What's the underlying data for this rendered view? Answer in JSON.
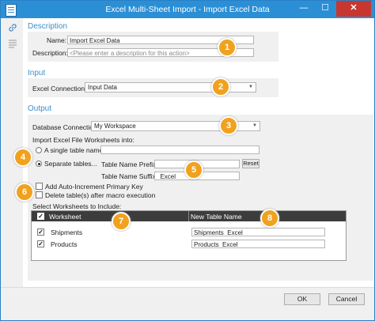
{
  "window": {
    "title": "Excel Multi-Sheet Import - Import Excel Data",
    "minimize": "—",
    "maximize": "☐",
    "close": "✕"
  },
  "description": {
    "section_title": "Description",
    "name_label": "Name:",
    "name_value": "Import Excel Data",
    "description_label": "Description:",
    "description_placeholder": "<Please enter a description for this action>"
  },
  "input": {
    "section_title": "Input",
    "connection_label": "Excel Connection:",
    "connection_value": "Input Data"
  },
  "output": {
    "section_title": "Output",
    "db_connection_label": "Database Connection:",
    "db_connection_value": "My Workspace",
    "import_into_label": "Import Excel File Worksheets into:",
    "single_table_label": "A single table named:",
    "separate_tables_label": "Separate tables...",
    "prefix_label": "Table Name Prefix:",
    "prefix_value": "",
    "reset_label": "Reset",
    "suffix_label": "Table Name Suffix:",
    "suffix_value": "_Excel",
    "auto_increment_label": "Add Auto-Increment Primary Key",
    "delete_tables_label": "Delete table(s) after macro execution",
    "select_worksheets_label": "Select Worksheets to Include:"
  },
  "grid": {
    "columns": [
      "Worksheet",
      "New Table Name"
    ],
    "rows": [
      {
        "worksheet": "Shipments",
        "table": "Shipments_Excel"
      },
      {
        "worksheet": "Products",
        "table": "Products_Excel"
      }
    ]
  },
  "badges": [
    "1",
    "2",
    "3",
    "4",
    "5",
    "6",
    "7",
    "8"
  ],
  "footer": {
    "ok_label": "OK",
    "cancel_label": "Cancel"
  },
  "colors": {
    "titlebar": "#2b8fd6",
    "section_title": "#3f8dc8",
    "badge": "#f0a21f",
    "grid_header": "#3c3c3c",
    "close_button": "#c7372f"
  },
  "icons": [
    "link-icon",
    "list-icon",
    "chevron-down-icon",
    "checkmark-icon"
  ]
}
